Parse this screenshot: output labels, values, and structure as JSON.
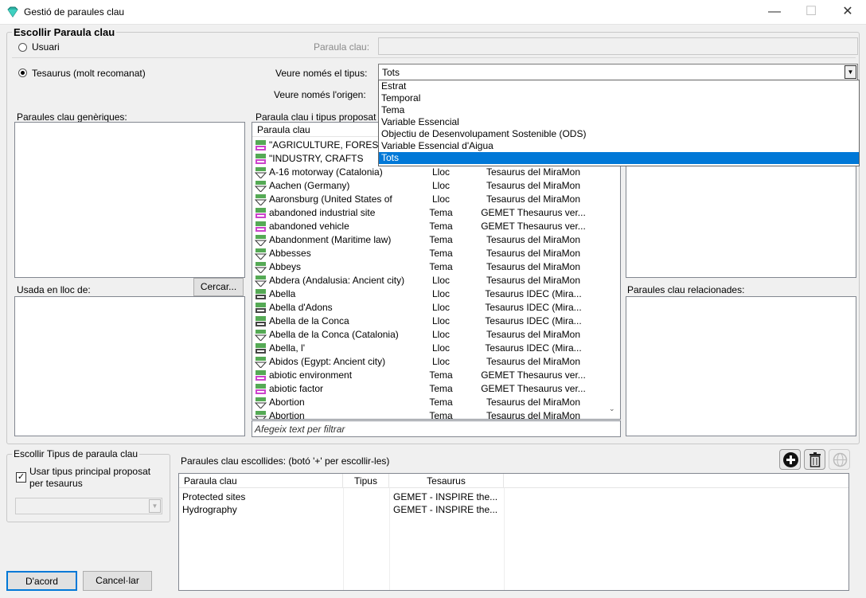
{
  "window": {
    "title": "Gestió de paraules clau",
    "minimize": "—",
    "maximize": "☐",
    "close": "✕"
  },
  "choose_group": {
    "label": "Escollir Paraula clau",
    "radio_user": "Usuari",
    "radio_thesaurus": "Tesaurus (molt recomanat)",
    "keyword_label": "Paraula clau:",
    "keyword_value": "",
    "type_label": "Veure només el tipus:",
    "type_value": "Tots",
    "origin_label": "Veure només l'origen:"
  },
  "dropdown": {
    "options": [
      "Estrat",
      "Temporal",
      "Tema",
      "Variable Essencial",
      "Objectiu de Desenvolupament Sostenible (ODS)",
      "Variable Essencial d'Aigua",
      "Tots"
    ],
    "selected": "Tots"
  },
  "left": {
    "generic_label": "Paraules clau genèriques:",
    "used_instead_label": "Usada en lloc de:",
    "search_button": "Cercar..."
  },
  "proposed": {
    "label": "Paraula clau i tipus proposat",
    "col_keyword": "Paraula clau",
    "rows": [
      {
        "kw": "\"AGRICULTURE, FOREST",
        "type": "",
        "src": "",
        "icon": "gemet"
      },
      {
        "kw": "\"INDUSTRY, CRAFTS",
        "type": "",
        "src": "",
        "icon": "gemet"
      },
      {
        "kw": "A-16 motorway (Catalonia)",
        "type": "Lloc",
        "src": "Tesaurus del MiraMon",
        "icon": "miramon"
      },
      {
        "kw": "Aachen (Germany)",
        "type": "Lloc",
        "src": "Tesaurus del MiraMon",
        "icon": "miramon"
      },
      {
        "kw": "Aaronsburg (United States of",
        "type": "Lloc",
        "src": "Tesaurus del MiraMon",
        "icon": "miramon"
      },
      {
        "kw": "abandoned industrial site",
        "type": "Tema",
        "src": "GEMET Thesaurus ver...",
        "icon": "gemet"
      },
      {
        "kw": "abandoned vehicle",
        "type": "Tema",
        "src": "GEMET Thesaurus ver...",
        "icon": "gemet"
      },
      {
        "kw": "Abandonment (Maritime law)",
        "type": "Tema",
        "src": "Tesaurus del MiraMon",
        "icon": "miramon"
      },
      {
        "kw": "Abbesses",
        "type": "Tema",
        "src": "Tesaurus del MiraMon",
        "icon": "miramon"
      },
      {
        "kw": "Abbeys",
        "type": "Tema",
        "src": "Tesaurus del MiraMon",
        "icon": "miramon"
      },
      {
        "kw": "Abdera (Andalusia: Ancient city)",
        "type": "Lloc",
        "src": "Tesaurus del MiraMon",
        "icon": "miramon"
      },
      {
        "kw": "Abella",
        "type": "Lloc",
        "src": "Tesaurus IDEC (Mira...",
        "icon": "idec"
      },
      {
        "kw": "Abella d'Adons",
        "type": "Lloc",
        "src": "Tesaurus IDEC (Mira...",
        "icon": "idec"
      },
      {
        "kw": "Abella de la Conca",
        "type": "Lloc",
        "src": "Tesaurus IDEC (Mira...",
        "icon": "idec"
      },
      {
        "kw": "Abella de la Conca (Catalonia)",
        "type": "Lloc",
        "src": "Tesaurus del MiraMon",
        "icon": "miramon"
      },
      {
        "kw": "Abella, l'",
        "type": "Lloc",
        "src": "Tesaurus IDEC (Mira...",
        "icon": "idec"
      },
      {
        "kw": "Abidos (Egypt: Ancient city)",
        "type": "Lloc",
        "src": "Tesaurus del MiraMon",
        "icon": "miramon"
      },
      {
        "kw": "abiotic environment",
        "type": "Tema",
        "src": "GEMET Thesaurus ver...",
        "icon": "gemet"
      },
      {
        "kw": "abiotic factor",
        "type": "Tema",
        "src": "GEMET Thesaurus ver...",
        "icon": "gemet"
      },
      {
        "kw": "Abortion",
        "type": "Tema",
        "src": "Tesaurus del MiraMon",
        "icon": "miramon"
      },
      {
        "kw": "Abortion",
        "type": "Tema",
        "src": "Tesaurus del MiraMon",
        "icon": "miramon"
      }
    ],
    "filter_placeholder": "Afegeix text per filtrar"
  },
  "right": {
    "related_label": "Paraules clau relacionades:"
  },
  "type_group": {
    "label": "Escollir Tipus de paraula clau",
    "checkbox_label_1": "Usar tipus principal proposat",
    "checkbox_label_2": "per tesaurus",
    "checked": true
  },
  "chosen": {
    "label": "Paraules clau escollides: (botó '+' per escollir-les)",
    "columns": [
      "Paraula clau",
      "Tipus",
      "Tesaurus"
    ],
    "rows": [
      {
        "kw": "Protected sites",
        "type": "",
        "thes": "GEMET - INSPIRE the..."
      },
      {
        "kw": "Hydrography",
        "type": "",
        "thes": "GEMET - INSPIRE the..."
      }
    ]
  },
  "buttons": {
    "ok": "D'acord",
    "cancel": "Cancel·lar"
  },
  "colors": {
    "selection": "#0078d7",
    "window_bg": "#f0f0f0"
  }
}
